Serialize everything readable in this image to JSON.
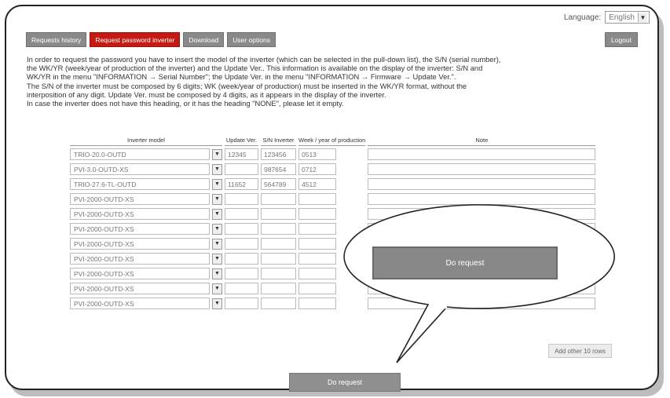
{
  "language": {
    "label": "Language:",
    "value": "English"
  },
  "tabs": [
    {
      "label": "Requests history"
    },
    {
      "label": "Request password inverter"
    },
    {
      "label": "Download"
    },
    {
      "label": "User options"
    }
  ],
  "logout_label": "Logout",
  "intro": [
    "In order to request the password you have to insert the model of the inverter (which can be selected in the pull-down list), the S/N (serial number),",
    "the WK/YR (week/year of production of the inverter) and the Update Ver.. This information is available on the display of the inverter: S/N and",
    "WK/YR in the menu \"INFORMATION → Serial Number\"; the Update Ver. in the menu \"INFORMATION → Firmware → Update Ver.\".",
    "The S/N of the inverter must be composed by 6 digits; WK (week/year of production) must be inserted in the WK/YR format, without the",
    "interposition of any digit. Update Ver. must be composed by 4 digits, as it appears in the display of the inverter.",
    "In case the inverter does not have this heading, or it has the heading \"NONE\", please let it empty."
  ],
  "table": {
    "headers": {
      "model": "Inverter model",
      "update": "Update Ver.",
      "sn": "S/N Inverter",
      "week": "Week / year of production",
      "note": "Note"
    },
    "rows": [
      {
        "model": "TRIO-20.0-OUTD",
        "update": "12345",
        "sn": "123456",
        "week": "0513",
        "note": ""
      },
      {
        "model": "PVI-3.0-OUTD-XS",
        "update": "",
        "sn": "987654",
        "week": "0712",
        "note": ""
      },
      {
        "model": "TRIO-27.6-TL-OUTD",
        "update": "11652",
        "sn": "564789",
        "week": "4512",
        "note": ""
      },
      {
        "model": "PVI-2000-OUTD-XS",
        "update": "",
        "sn": "",
        "week": "",
        "note": ""
      },
      {
        "model": "PVI-2000-OUTD-XS",
        "update": "",
        "sn": "",
        "week": "",
        "note": ""
      },
      {
        "model": "PVI-2000-OUTD-XS",
        "update": "",
        "sn": "",
        "week": "",
        "note": ""
      },
      {
        "model": "PVI-2000-OUTD-XS",
        "update": "",
        "sn": "",
        "week": "",
        "note": ""
      },
      {
        "model": "PVI-2000-OUTD-XS",
        "update": "",
        "sn": "",
        "week": "",
        "note": ""
      },
      {
        "model": "PVI-2000-OUTD-XS",
        "update": "",
        "sn": "",
        "week": "",
        "note": ""
      },
      {
        "model": "PVI-2000-OUTD-XS",
        "update": "",
        "sn": "",
        "week": "",
        "note": ""
      },
      {
        "model": "PVI-2000-OUTD-XS",
        "update": "",
        "sn": "",
        "week": "",
        "note": ""
      }
    ]
  },
  "add_rows_label": "Add other 10 rows",
  "do_request_label": "Do request",
  "callout_button_label": "Do request",
  "colors": {
    "active_tab": "#c41a14",
    "tab": "#8a8a8a"
  }
}
